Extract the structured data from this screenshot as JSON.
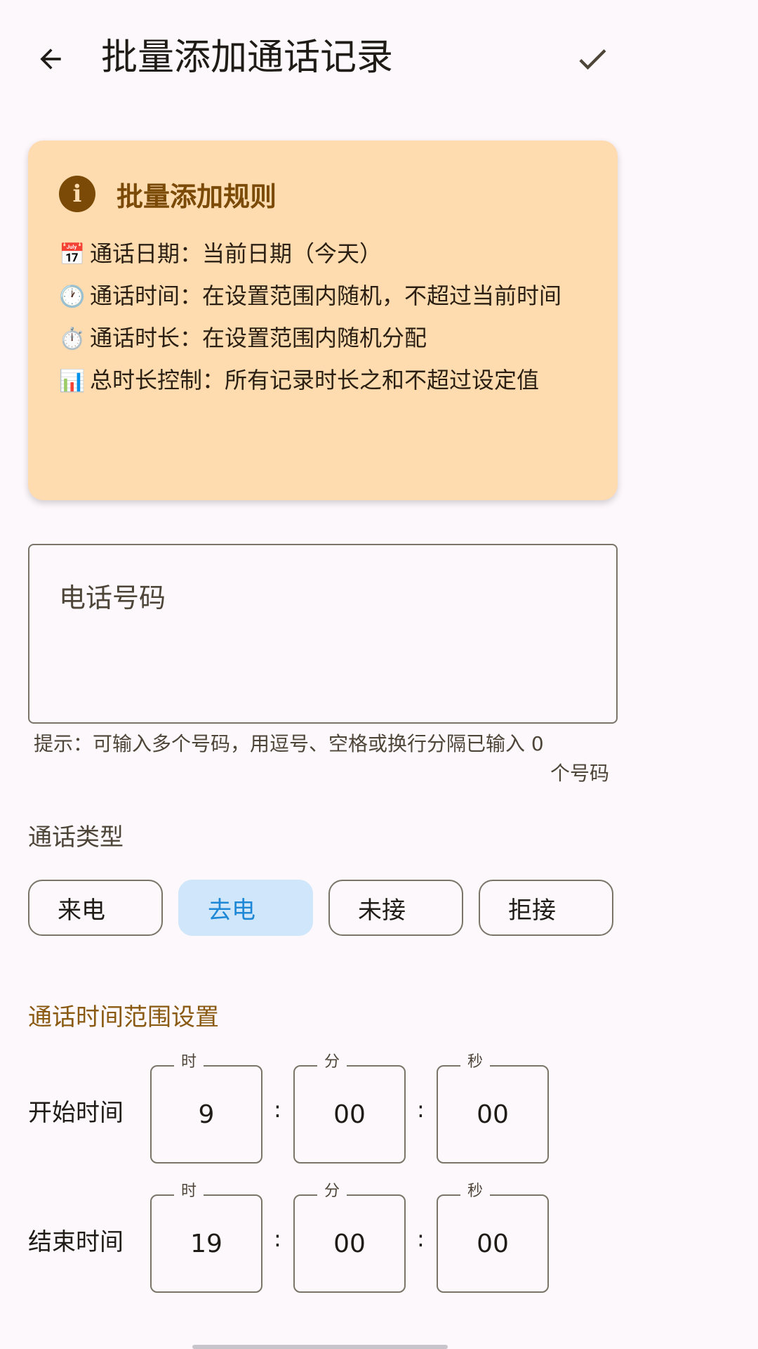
{
  "appbar": {
    "title": "批量添加通话记录",
    "back_icon": "arrow-back-icon",
    "confirm_icon": "check-icon"
  },
  "rules": {
    "title": "批量添加规则",
    "items": [
      {
        "emoji": "📅",
        "text": "通话日期：当前日期（今天）"
      },
      {
        "emoji": "🕐",
        "text": "通话时间：在设置范围内随机，不超过当前时间"
      },
      {
        "emoji": "⏱️",
        "text": "通话时长：在设置范围内随机分配"
      },
      {
        "emoji": "📊",
        "text": "总时长控制：所有记录时长之和不超过设定值"
      }
    ]
  },
  "phone": {
    "placeholder": "电话号码",
    "hint": "提示：可输入多个号码，用逗号、空格或换行分隔已输入 0",
    "hint_count": "个号码"
  },
  "call_type": {
    "label": "通话类型",
    "options": [
      "来电",
      "去电",
      "未接",
      "拒接"
    ],
    "selected": "去电"
  },
  "time_range": {
    "title": "通话时间范围设置",
    "unit_labels": [
      "时",
      "分",
      "秒"
    ],
    "start": {
      "label": "开始时间",
      "hour": "9",
      "minute": "00",
      "second": "00"
    },
    "end": {
      "label": "结束时间",
      "hour": "19",
      "minute": "00",
      "second": "00"
    }
  },
  "colors": {
    "card_bg": "#ffdcb0",
    "accent_brown": "#7a4a06",
    "selected_chip_bg": "#cfe6fb",
    "selected_chip_text": "#1e88d6"
  }
}
